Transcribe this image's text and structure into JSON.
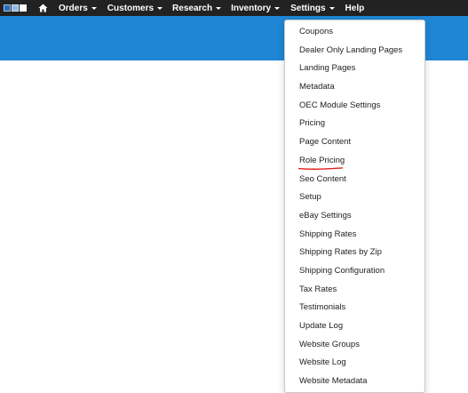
{
  "nav": {
    "home_icon": "home-icon",
    "menus": [
      {
        "label": "Orders"
      },
      {
        "label": "Customers"
      },
      {
        "label": "Research"
      },
      {
        "label": "Inventory"
      },
      {
        "label": "Settings"
      },
      {
        "label": "Help"
      }
    ]
  },
  "settings_menu": {
    "items": [
      {
        "label": "Coupons"
      },
      {
        "label": "Dealer Only Landing Pages"
      },
      {
        "label": "Landing Pages"
      },
      {
        "label": "Metadata"
      },
      {
        "label": "OEC Module Settings"
      },
      {
        "label": "Pricing"
      },
      {
        "label": "Page Content"
      },
      {
        "label": "Role Pricing"
      },
      {
        "label": "Seo Content"
      },
      {
        "label": "Setup"
      },
      {
        "label": "eBay Settings"
      },
      {
        "label": "Shipping Rates"
      },
      {
        "label": "Shipping Rates by Zip"
      },
      {
        "label": "Shipping Configuration"
      },
      {
        "label": "Tax Rates"
      },
      {
        "label": "Testimonials"
      },
      {
        "label": "Update Log"
      },
      {
        "label": "Website Groups"
      },
      {
        "label": "Website Log"
      },
      {
        "label": "Website Metadata"
      }
    ],
    "highlighted_item": "Role Pricing",
    "highlight_color": "#e0201a"
  },
  "colors": {
    "topbar": "#222222",
    "banner": "#1e86d4"
  }
}
